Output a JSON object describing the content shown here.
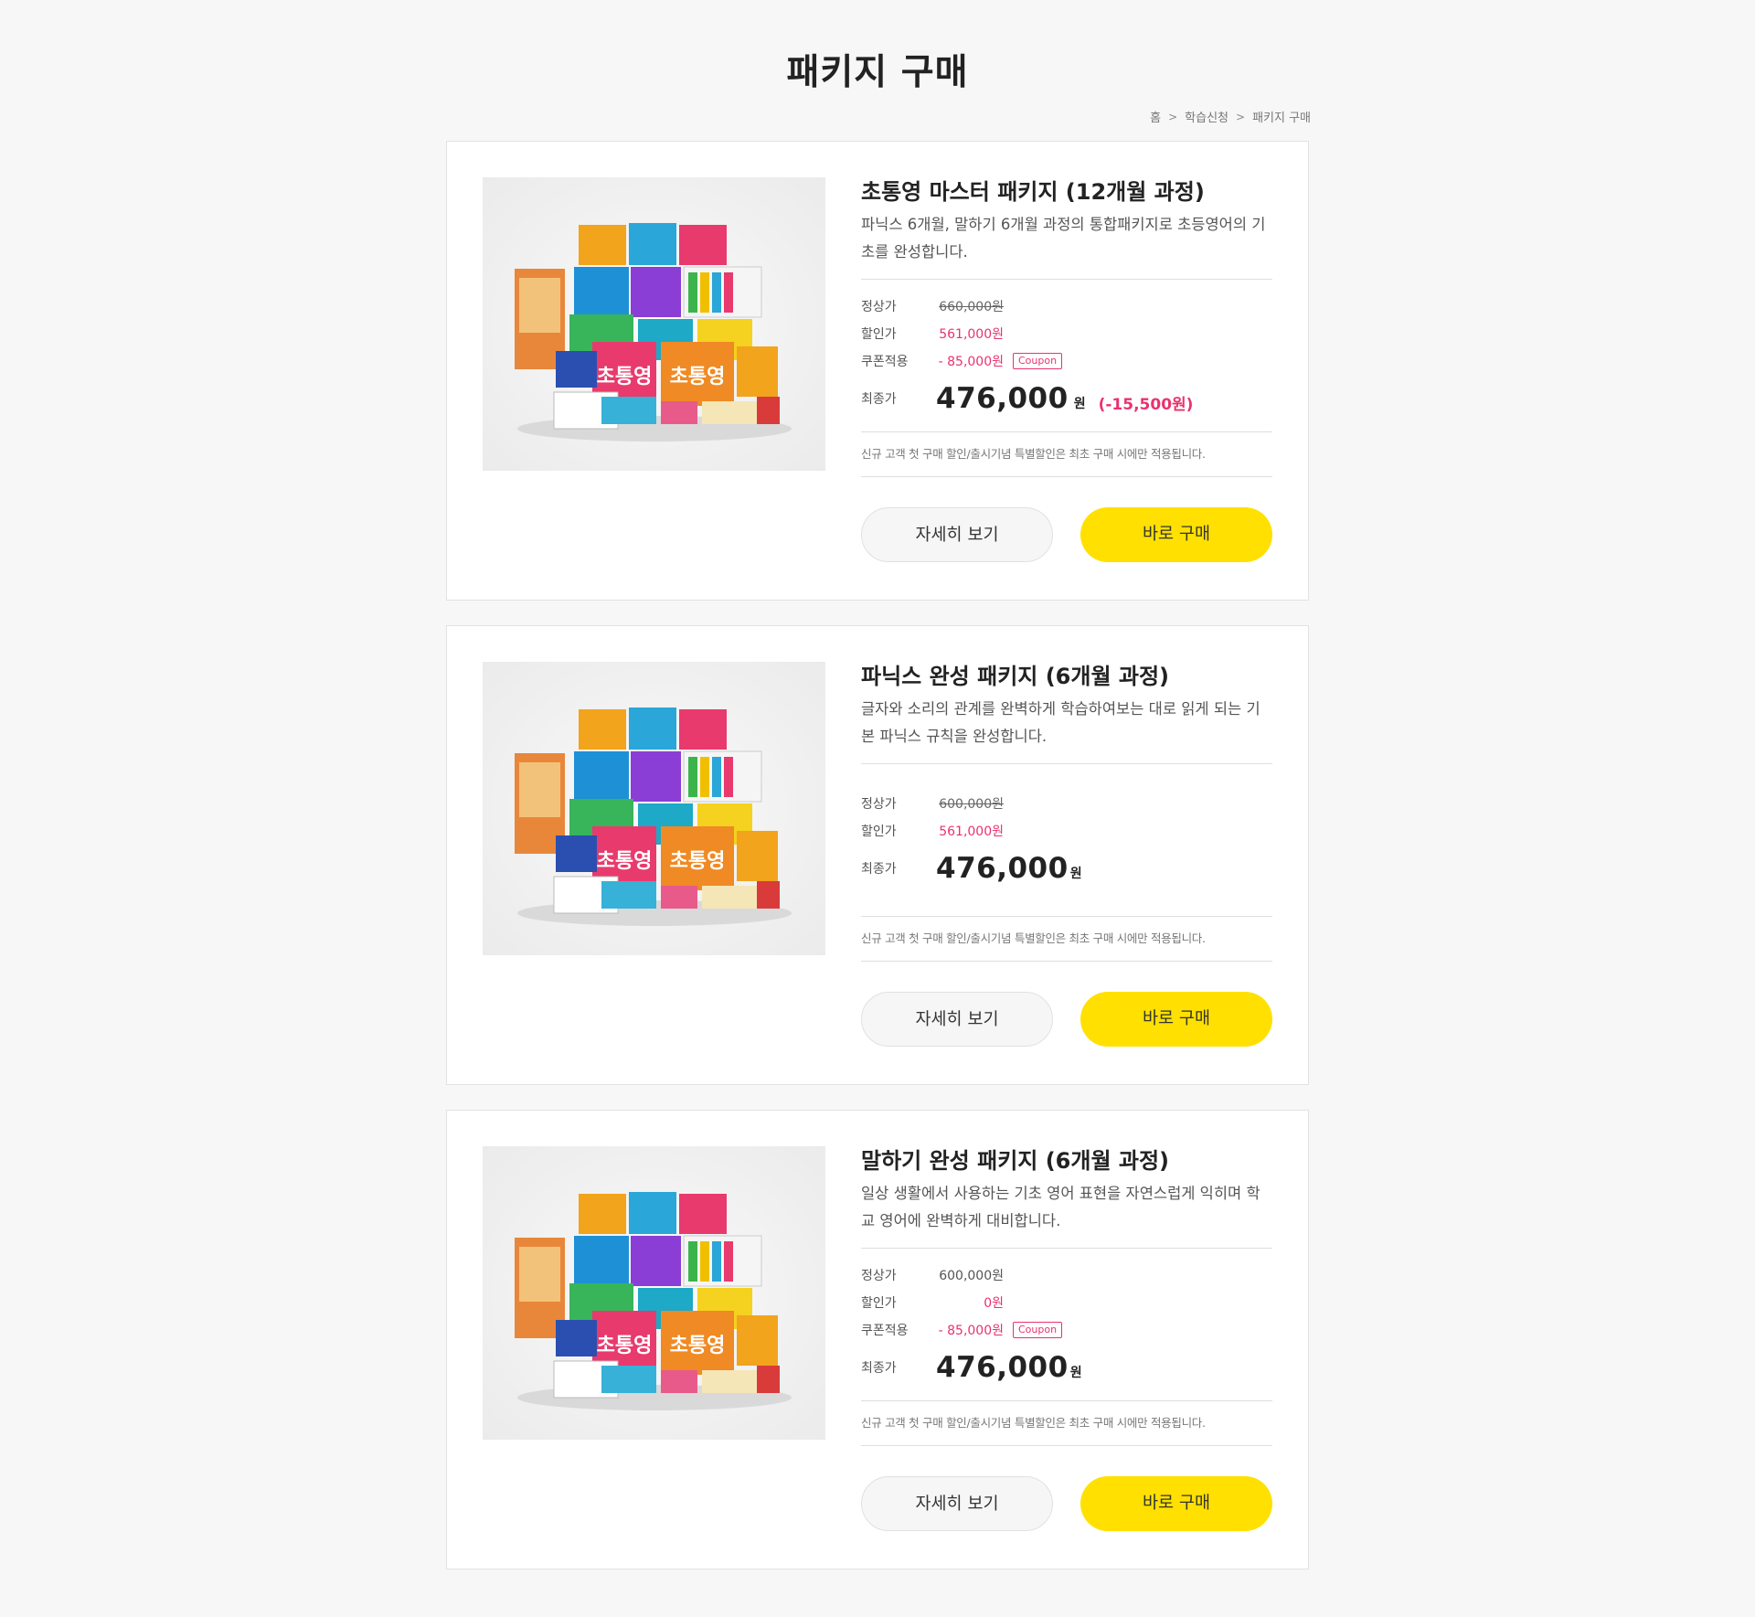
{
  "header": {
    "title": "패키지 구매"
  },
  "breadcrumb": [
    "홈",
    "학습신청",
    "패키지 구매"
  ],
  "common": {
    "detail_label": "자세히 보기",
    "buy_label": "바로 구매",
    "notice": "신규 고객 첫 구매 할인/출시기념 특별할인은 최초 구매 시에만 적용됩니다.",
    "label_regular": "정상가",
    "label_discount": "할인가",
    "label_coupon": "쿠폰적용",
    "label_final": "최종가",
    "coupon_badge": "Coupon",
    "currency": "원"
  },
  "packages": [
    {
      "name": "초통영 마스터 패키지 (12개월 과정)",
      "desc": "파닉스 6개월, 말하기 6개월 과정의 통합패키지로 초등영어의 기초를 완성합니다.",
      "regular": "660,000원",
      "discount": "561,000원",
      "coupon": "- 85,000원",
      "final": "476,000",
      "saving": "(-15,500원)"
    },
    {
      "name": "파닉스 완성 패키지 (6개월 과정)",
      "desc": "글자와 소리의 관계를 완벽하게 학습하여보는 대로 읽게 되는 기본 파닉스 규칙을 완성합니다.",
      "regular": "600,000원",
      "discount": "561,000원",
      "final": "476,000"
    },
    {
      "name": "말하기 완성 패키지 (6개월 과정)",
      "desc": "일상 생활에서 사용하는 기초 영어 표현을 자연스럽게 익히며 학교 영어에 완벽하게 대비합니다.",
      "regular": "600,000원",
      "discount": "0원",
      "coupon": "- 85,000원",
      "final": "476,000"
    }
  ],
  "colors": {
    "accent": "#ffe000",
    "sale": "#e8336e",
    "background": "#f7f7f7"
  },
  "icons": {
    "breadcrumb_separator": "chevron-right-icon",
    "product_image": "book-bundle-image"
  }
}
